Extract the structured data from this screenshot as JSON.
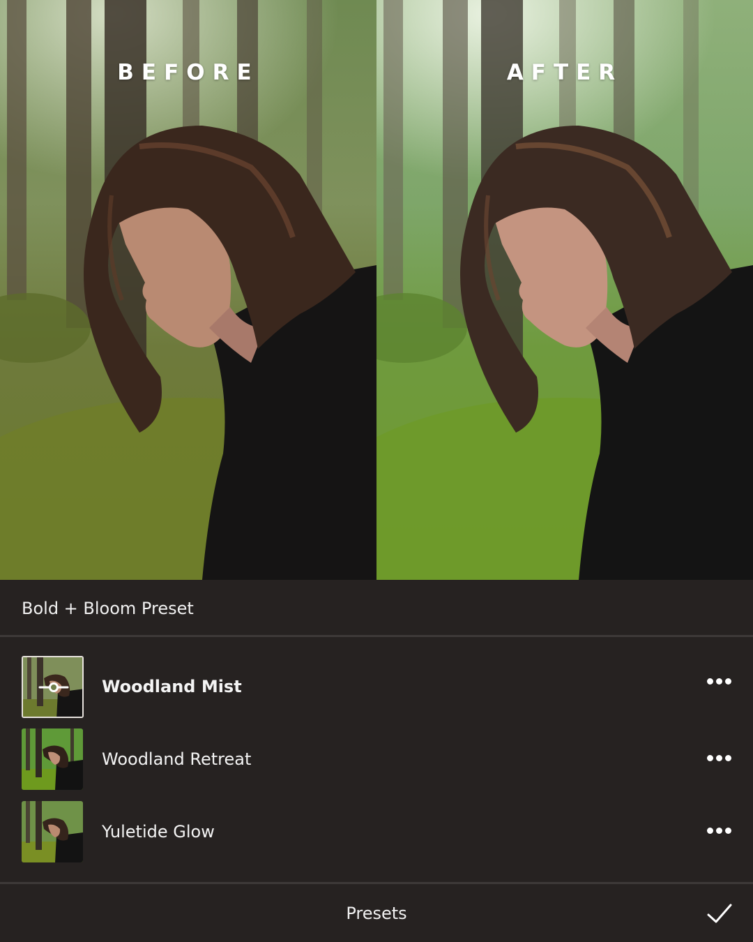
{
  "comparison": {
    "before_label": "BEFORE",
    "after_label": "AFTER"
  },
  "collection": {
    "title": "Bold + Bloom Preset"
  },
  "presets": [
    {
      "name": "Woodland Mist",
      "selected": true,
      "menu_icon": "more-horizontal-icon",
      "thumb_icon": "adjust-slider-icon"
    },
    {
      "name": "Woodland Retreat",
      "selected": false,
      "menu_icon": "more-horizontal-icon"
    },
    {
      "name": "Yuletide Glow",
      "selected": false,
      "menu_icon": "more-horizontal-icon"
    }
  ],
  "bottom_bar": {
    "label": "Presets",
    "confirm_icon": "checkmark-icon"
  },
  "colors": {
    "panel_background": "#262221",
    "divider": "#3d3938",
    "text": "#f2f2f2"
  }
}
